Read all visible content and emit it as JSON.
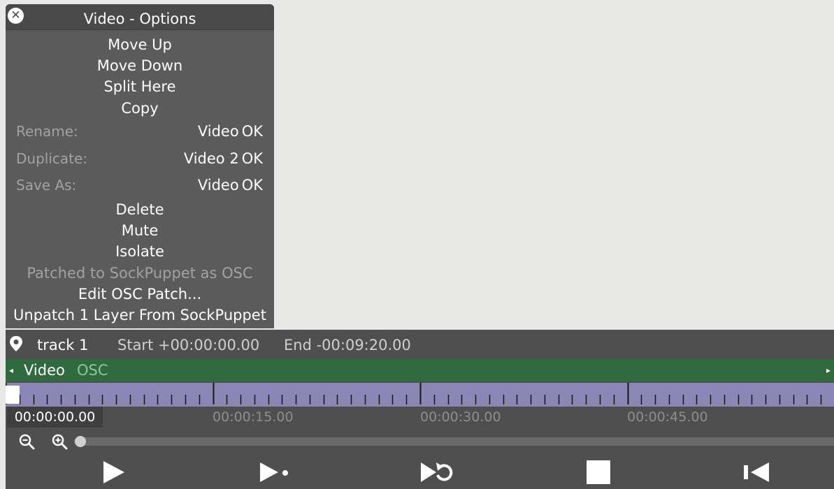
{
  "panel": {
    "title": "Video - Options",
    "items": {
      "move_up": "Move Up",
      "move_down": "Move Down",
      "split_here": "Split Here",
      "copy": "Copy",
      "delete": "Delete",
      "mute": "Mute",
      "isolate": "Isolate",
      "patched_status": "Patched to SockPuppet as OSC",
      "edit_osc_patch": "Edit OSC Patch...",
      "unpatch": "Unpatch 1 Layer From SockPuppet"
    },
    "rename": {
      "label": "Rename:",
      "value": "Video",
      "ok": "OK"
    },
    "duplicate": {
      "label": "Duplicate:",
      "value": "Video 2",
      "ok": "OK"
    },
    "save_as": {
      "label": "Save As:",
      "value": "Video",
      "ok": "OK"
    }
  },
  "track": {
    "name": "track 1",
    "start": "Start +00:00:00.00",
    "end": "End -00:09:20.00"
  },
  "layer": {
    "name": "Video",
    "tag": "OSC"
  },
  "timeline": {
    "current_time": "00:00:00.00",
    "labels": [
      "00:00:15.00",
      "00:00:30.00",
      "00:00:45.00"
    ],
    "zoom_level": 0
  },
  "icons": {
    "close": "close-icon",
    "pin": "pin-icon",
    "zoom_out": "zoom-out-icon",
    "zoom_in": "zoom-in-icon",
    "play": "play-icon",
    "play_to_cue": "play-to-cue-icon",
    "loop": "loop-icon",
    "stop": "stop-icon",
    "rewind": "rewind-icon"
  },
  "colors": {
    "panel_bg": "#5b5b5b",
    "layer_green": "#2f6b3e",
    "ruler_purple": "#8b87b5"
  }
}
